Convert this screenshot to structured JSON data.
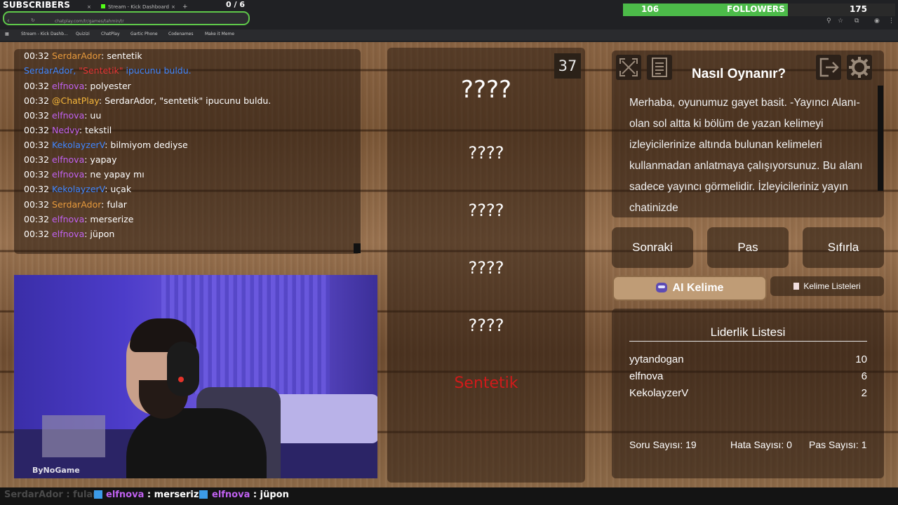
{
  "overlay": {
    "subscribers_label": "SUBSCRIBERS",
    "subscribers_count": "0 / 6",
    "followers_current": "106",
    "followers_label": "FOLLOWERS",
    "followers_goal": "175",
    "followers_progress": 0.605
  },
  "browser": {
    "tabs": [
      "Stream - Kick Dashboard"
    ],
    "tab_add": "+",
    "address": "chatplay.com/tr/games/tahmin/tr",
    "bookmarks": [
      "Stream - Kick Dashb...",
      "Quizizi",
      "ChatPlay",
      "Gartic Phone",
      "Codenames",
      "Make it Meme"
    ]
  },
  "chat": {
    "lines": [
      {
        "time": "00:32",
        "user": "SerdarAdor",
        "msg": ": sentetik",
        "color": "orange"
      },
      {
        "time": "",
        "user": "SerdarAdor, ",
        "msg": " ipucunu buldu.",
        "highlight": "\"Sentetik\"",
        "color": "blue"
      },
      {
        "time": "00:32",
        "user": "elfnova",
        "msg": ": polyester",
        "color": "purple"
      },
      {
        "time": "00:32",
        "user": "@ChatPlay",
        "msg": ": SerdarAdor, \"sentetik\" ipucunu buldu.",
        "color": "gold"
      },
      {
        "time": "00:32",
        "user": "elfnova",
        "msg": ": uu",
        "color": "purple"
      },
      {
        "time": "00:32",
        "user": "Nedvy",
        "msg": ": tekstil",
        "color": "purple"
      },
      {
        "time": "00:32",
        "user": "KekolayzerV",
        "msg": ": bilmiyom dediyse",
        "color": "blue"
      },
      {
        "time": "00:32",
        "user": "elfnova",
        "msg": ": yapay",
        "color": "purple"
      },
      {
        "time": "00:32",
        "user": "elfnova",
        "msg": ": ne yapay mı",
        "color": "purple"
      },
      {
        "time": "00:32",
        "user": "KekolayzerV",
        "msg": ": uçak",
        "color": "blue"
      },
      {
        "time": "00:32",
        "user": "SerdarAdor",
        "msg": ": fular",
        "color": "orange"
      },
      {
        "time": "00:32",
        "user": "elfnova",
        "msg": ": merserize",
        "color": "purple"
      },
      {
        "time": "00:32",
        "user": "elfnova",
        "msg": ": jüpon",
        "color": "purple"
      }
    ]
  },
  "cam": {
    "logo": "ByNoGame"
  },
  "game": {
    "timer": "37",
    "hidden_words": [
      "????",
      "????",
      "????",
      "????",
      "????"
    ],
    "answer": "Sentetik"
  },
  "howto": {
    "title": "Nasıl Oynanır?",
    "text": "Merhaba, oyunumuz gayet basit. -Yayıncı Alanı- olan sol altta ki bölüm de yazan kelimeyi izleyicilerinize altında bulunan kelimeleri kullanmadan anlatmaya çalışıyorsunuz. Bu alanı sadece yayıncı görmelidir. İzleyicileriniz yayın chatinizde",
    "icons": [
      "fullscreen-icon",
      "document-icon",
      "exit-icon",
      "gear-icon"
    ]
  },
  "controls": {
    "next": "Sonraki",
    "pass": "Pas",
    "reset": "Sıfırla",
    "ai_word": "AI Kelime",
    "word_lists": "Kelime Listeleri"
  },
  "leaderboard": {
    "title": "Liderlik Listesi",
    "rows": [
      {
        "name": "yytandogan",
        "score": "10"
      },
      {
        "name": "elfnova",
        "score": "6"
      },
      {
        "name": "KekolayzerV",
        "score": "2"
      }
    ],
    "stats": {
      "questions": "Soru Sayısı: 19",
      "errors": "Hata Sayısı: 0",
      "passes": "Pas Sayısı: 1"
    }
  },
  "ticker": {
    "items": [
      {
        "user": "SerdarAdor",
        "msg": " : fular"
      },
      {
        "user": "elfnova",
        "msg": " : merserize"
      },
      {
        "user": "elfnova",
        "msg": " : jüpon"
      }
    ]
  },
  "colors": {
    "orange": "#e89a3c",
    "purple": "#c061f0",
    "blue": "#3f86ff",
    "gold": "#f5b63a",
    "red": "#e43434",
    "followers_bar": "#4cbb49",
    "answer": "#d11a1a"
  }
}
